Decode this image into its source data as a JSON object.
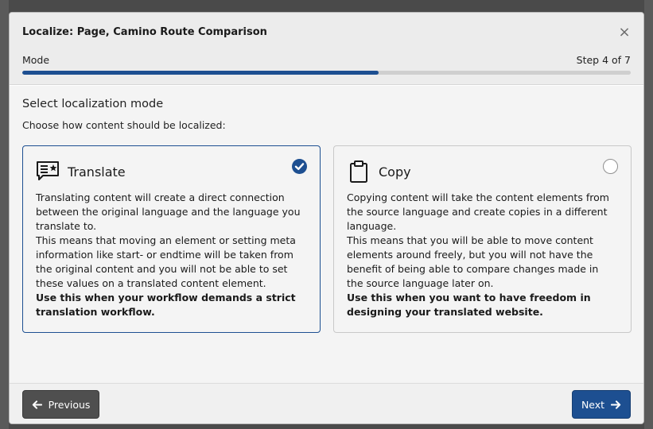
{
  "modal": {
    "title": "Localize: Page, Camino Route Comparison",
    "close_symbol": "×",
    "step_name": "Mode",
    "step_count": "Step 4 of 7",
    "progress_fraction": 0.586
  },
  "body": {
    "title": "Select localization mode",
    "subtitle": "Choose how content should be localized:"
  },
  "options": [
    {
      "title": "Translate",
      "icon": "comment-star-icon",
      "selected": true,
      "paragraphs": [
        "Translating content will create a direct connection between the original language and the language you translate to.",
        "This means that moving an element or setting meta information like start- or endtime will be taken from the original content and you will not be able to set these values on a translated content element."
      ],
      "emphasis": "Use this when your workflow demands a strict translation workflow."
    },
    {
      "title": "Copy",
      "icon": "clipboard-icon",
      "selected": false,
      "paragraphs": [
        "Copying content will take the content elements from the source language and create copies in a different language.",
        "This means that you will be able to move content elements around freely, but you will not have the benefit of being able to compare changes made in the source language later on."
      ],
      "emphasis": "Use this when you want to have freedom in designing your translated website."
    }
  ],
  "footer": {
    "previous_label": "Previous",
    "next_label": "Next"
  },
  "colors": {
    "accent": "#1d4f91",
    "previous_button": "#4f4f4f"
  }
}
